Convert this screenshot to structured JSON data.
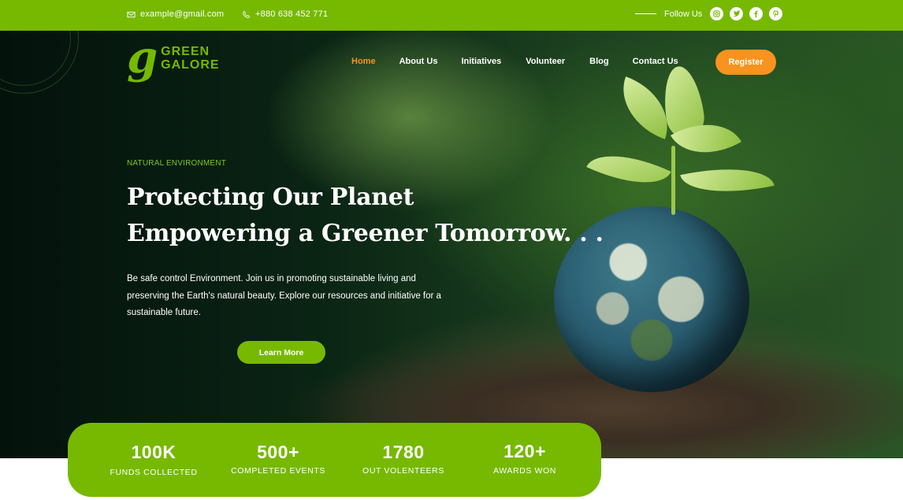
{
  "topbar": {
    "email": "example@gmail.com",
    "phone": "+880 638 452 771",
    "follow_label": "Follow Us",
    "socials": [
      "instagram-icon",
      "twitter-icon",
      "facebook-icon",
      "pinterest-icon"
    ]
  },
  "brand": {
    "mark": "g",
    "line1": "GREEN",
    "line2": "GALORE"
  },
  "nav": {
    "items": [
      {
        "label": "Home",
        "active": true
      },
      {
        "label": "About Us"
      },
      {
        "label": "Initiatives"
      },
      {
        "label": "Volunteer"
      },
      {
        "label": "Blog"
      },
      {
        "label": "Contact Us"
      }
    ],
    "register_label": "Register"
  },
  "hero": {
    "eyebrow": "NATURAL ENVIRONMENT",
    "headline_line1": "Protecting Our Planet",
    "headline_line2": "Empowering a Greener Tomorrow. . .",
    "description": "Be safe control Environment. Join us in promoting sustainable living and preserving the Earth's natural beauty. Explore our resources and initiative for a sustainable future.",
    "cta_label": "Learn More"
  },
  "stats": [
    {
      "value": "100K",
      "label": "FUNDS COLLECTED"
    },
    {
      "value": "500+",
      "label": "COMPLETED EVENTS"
    },
    {
      "value": "1780",
      "label": "OUT VOLENTEERS"
    },
    {
      "value": "120+",
      "label": "AWARDS WON"
    }
  ],
  "colors": {
    "primary_green": "#76b900",
    "accent_orange": "#f7931e"
  }
}
